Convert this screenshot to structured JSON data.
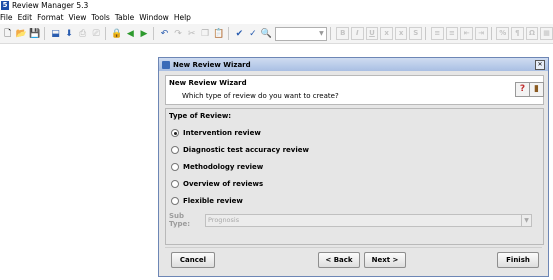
{
  "app": {
    "title": "Review Manager 5.3",
    "icon_letter": "5"
  },
  "menubar": {
    "items": [
      {
        "label": "File"
      },
      {
        "label": "Edit"
      },
      {
        "label": "Format"
      },
      {
        "label": "View"
      },
      {
        "label": "Tools"
      },
      {
        "label": "Table"
      },
      {
        "label": "Window"
      },
      {
        "label": "Help"
      }
    ]
  },
  "dialog": {
    "title": "New Review Wizard",
    "header_title": "New Review Wizard",
    "header_subtitle": "Which type of review do you want to create?",
    "section_title": "Type of Review:",
    "options": [
      {
        "label": "Intervention review",
        "selected": true
      },
      {
        "label": "Diagnostic test accuracy review",
        "selected": false
      },
      {
        "label": "Methodology review",
        "selected": false
      },
      {
        "label": "Overview of reviews",
        "selected": false
      },
      {
        "label": "Flexible review",
        "selected": false
      }
    ],
    "subtype": {
      "label": "Sub Type:",
      "value": "Prognosis"
    },
    "buttons": {
      "cancel": "Cancel",
      "back": "< Back",
      "next": "Next >",
      "finish": "Finish"
    }
  },
  "colors": {
    "dialog_title_bar": "#a9bfe3",
    "dialog_background": "#e6e6e6",
    "app_icon": "#1f4fa8"
  }
}
